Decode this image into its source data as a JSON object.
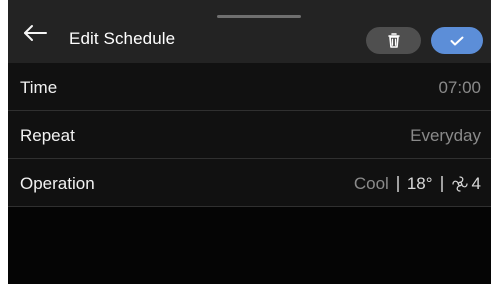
{
  "header": {
    "title": "Edit Schedule",
    "back_icon": "arrow-left-icon",
    "delete_icon": "trash-icon",
    "confirm_icon": "check-icon"
  },
  "rows": [
    {
      "label": "Time",
      "value": "07:00"
    },
    {
      "label": "Repeat",
      "value": "Everyday"
    },
    {
      "label": "Operation",
      "mode": "Cool",
      "temperature": "18°",
      "fan_icon": "fan-icon",
      "fan_speed": "4"
    }
  ],
  "colors": {
    "background": "#050505",
    "header": "#232323",
    "row_background": "#111111",
    "divider": "#303030",
    "delete_button": "#4f4f4f",
    "confirm_button": "#5c8ed8",
    "muted_text": "#8a8a8a"
  }
}
